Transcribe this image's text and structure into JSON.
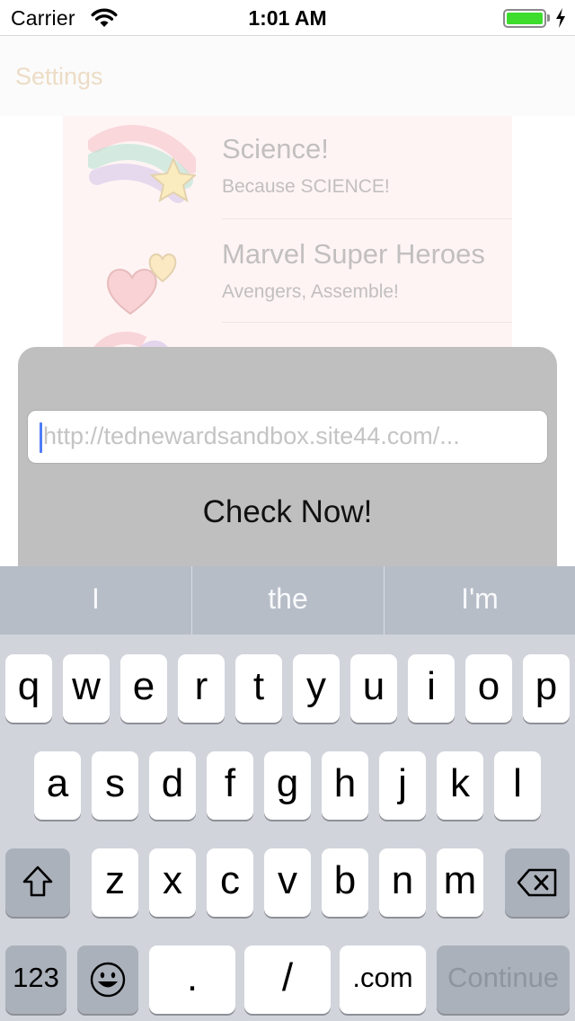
{
  "status_bar": {
    "carrier": "Carrier",
    "time": "1:01 AM",
    "battery_level": 1.0,
    "battery_color": "#3ddc2d"
  },
  "nav_bar": {
    "settings_label": "Settings"
  },
  "list": {
    "rows": [
      {
        "title": "Science!",
        "subtitle": "Because SCIENCE!",
        "icon": "shooting-star-icon"
      },
      {
        "title": "Marvel Super Heroes",
        "subtitle": "Avengers, Assemble!",
        "icon": "hearts-icon"
      },
      {
        "title": "",
        "subtitle": "",
        "icon": "rainbow-icon"
      }
    ]
  },
  "popup": {
    "url_placeholder": "http://tednewardsandbox.site44.com/...",
    "check_button": "Check Now!"
  },
  "keyboard": {
    "suggestions": [
      "I",
      "the",
      "I'm"
    ],
    "row1": [
      "q",
      "w",
      "e",
      "r",
      "t",
      "y",
      "u",
      "i",
      "o",
      "p"
    ],
    "row2": [
      "a",
      "s",
      "d",
      "f",
      "g",
      "h",
      "j",
      "k",
      "l"
    ],
    "row3": [
      "z",
      "x",
      "c",
      "v",
      "b",
      "n",
      "m"
    ],
    "bottom": {
      "numbers": "123",
      "period": ".",
      "slash": "/",
      "dotcom": ".com",
      "continue": "Continue"
    },
    "icons": {
      "shift": "shift-icon",
      "delete": "delete-icon",
      "emoji": "emoji-icon"
    }
  }
}
